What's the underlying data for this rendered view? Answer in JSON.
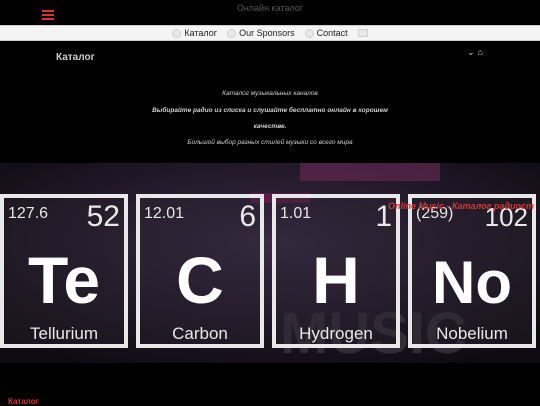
{
  "header": {
    "title": "Онлайн каталог"
  },
  "nav": {
    "items": [
      {
        "label": "Каталог"
      },
      {
        "label": "Our Sponsors"
      },
      {
        "label": "Contact"
      }
    ]
  },
  "main": {
    "heading": "Каталог",
    "description_lines": [
      "Каталог музыкальных каналов",
      "Выбирайте радио из списка и слушайте бесплатно онлайн в хорошем",
      "качестве.",
      "Большой выбор разных стилей музыки со всего мира"
    ]
  },
  "banner": {
    "marquee": "Online Music - Каталог радиост",
    "elements": [
      {
        "mass": "127.6",
        "number": "52",
        "symbol": "Te",
        "name": "Tellurium"
      },
      {
        "mass": "12.01",
        "number": "6",
        "symbol": "C",
        "name": "Carbon"
      },
      {
        "mass": "1.01",
        "number": "1",
        "symbol": "H",
        "name": "Hydrogen"
      },
      {
        "mass": "(259)",
        "number": "102",
        "symbol": "No",
        "name": "Nobelium"
      }
    ]
  },
  "footer": {
    "label": "Каталог"
  },
  "colors": {
    "accent": "#d9352f",
    "background": "#000000",
    "navbar": "#f4f4f4"
  }
}
